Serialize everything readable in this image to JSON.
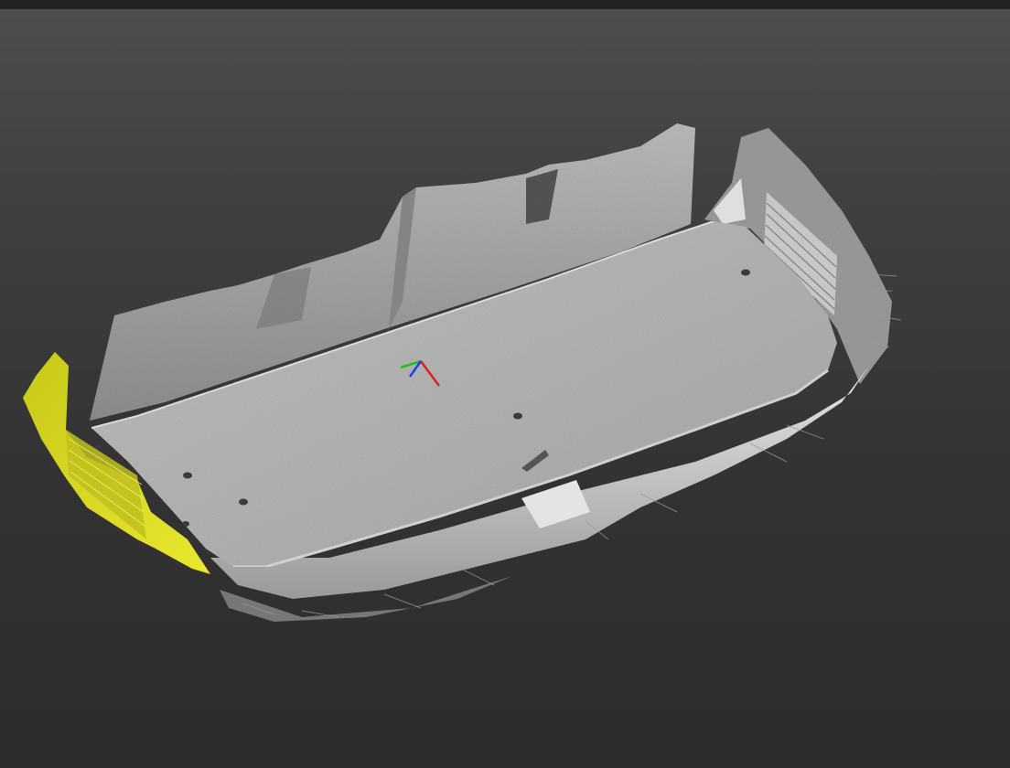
{
  "viewport": {
    "background_top": "#4e4e4e",
    "background_bottom": "#2c2c2c",
    "top_strip_color": "#222222"
  },
  "scan": {
    "surface_color": "#b4b4b4",
    "wall_color": "#9e9e9e",
    "highlight_color": "#d0d0d0",
    "selection_color": "#d8d820"
  },
  "axis_gizmo": {
    "x_color": "#e02020",
    "y_color": "#20c020",
    "z_color": "#2040e0"
  }
}
